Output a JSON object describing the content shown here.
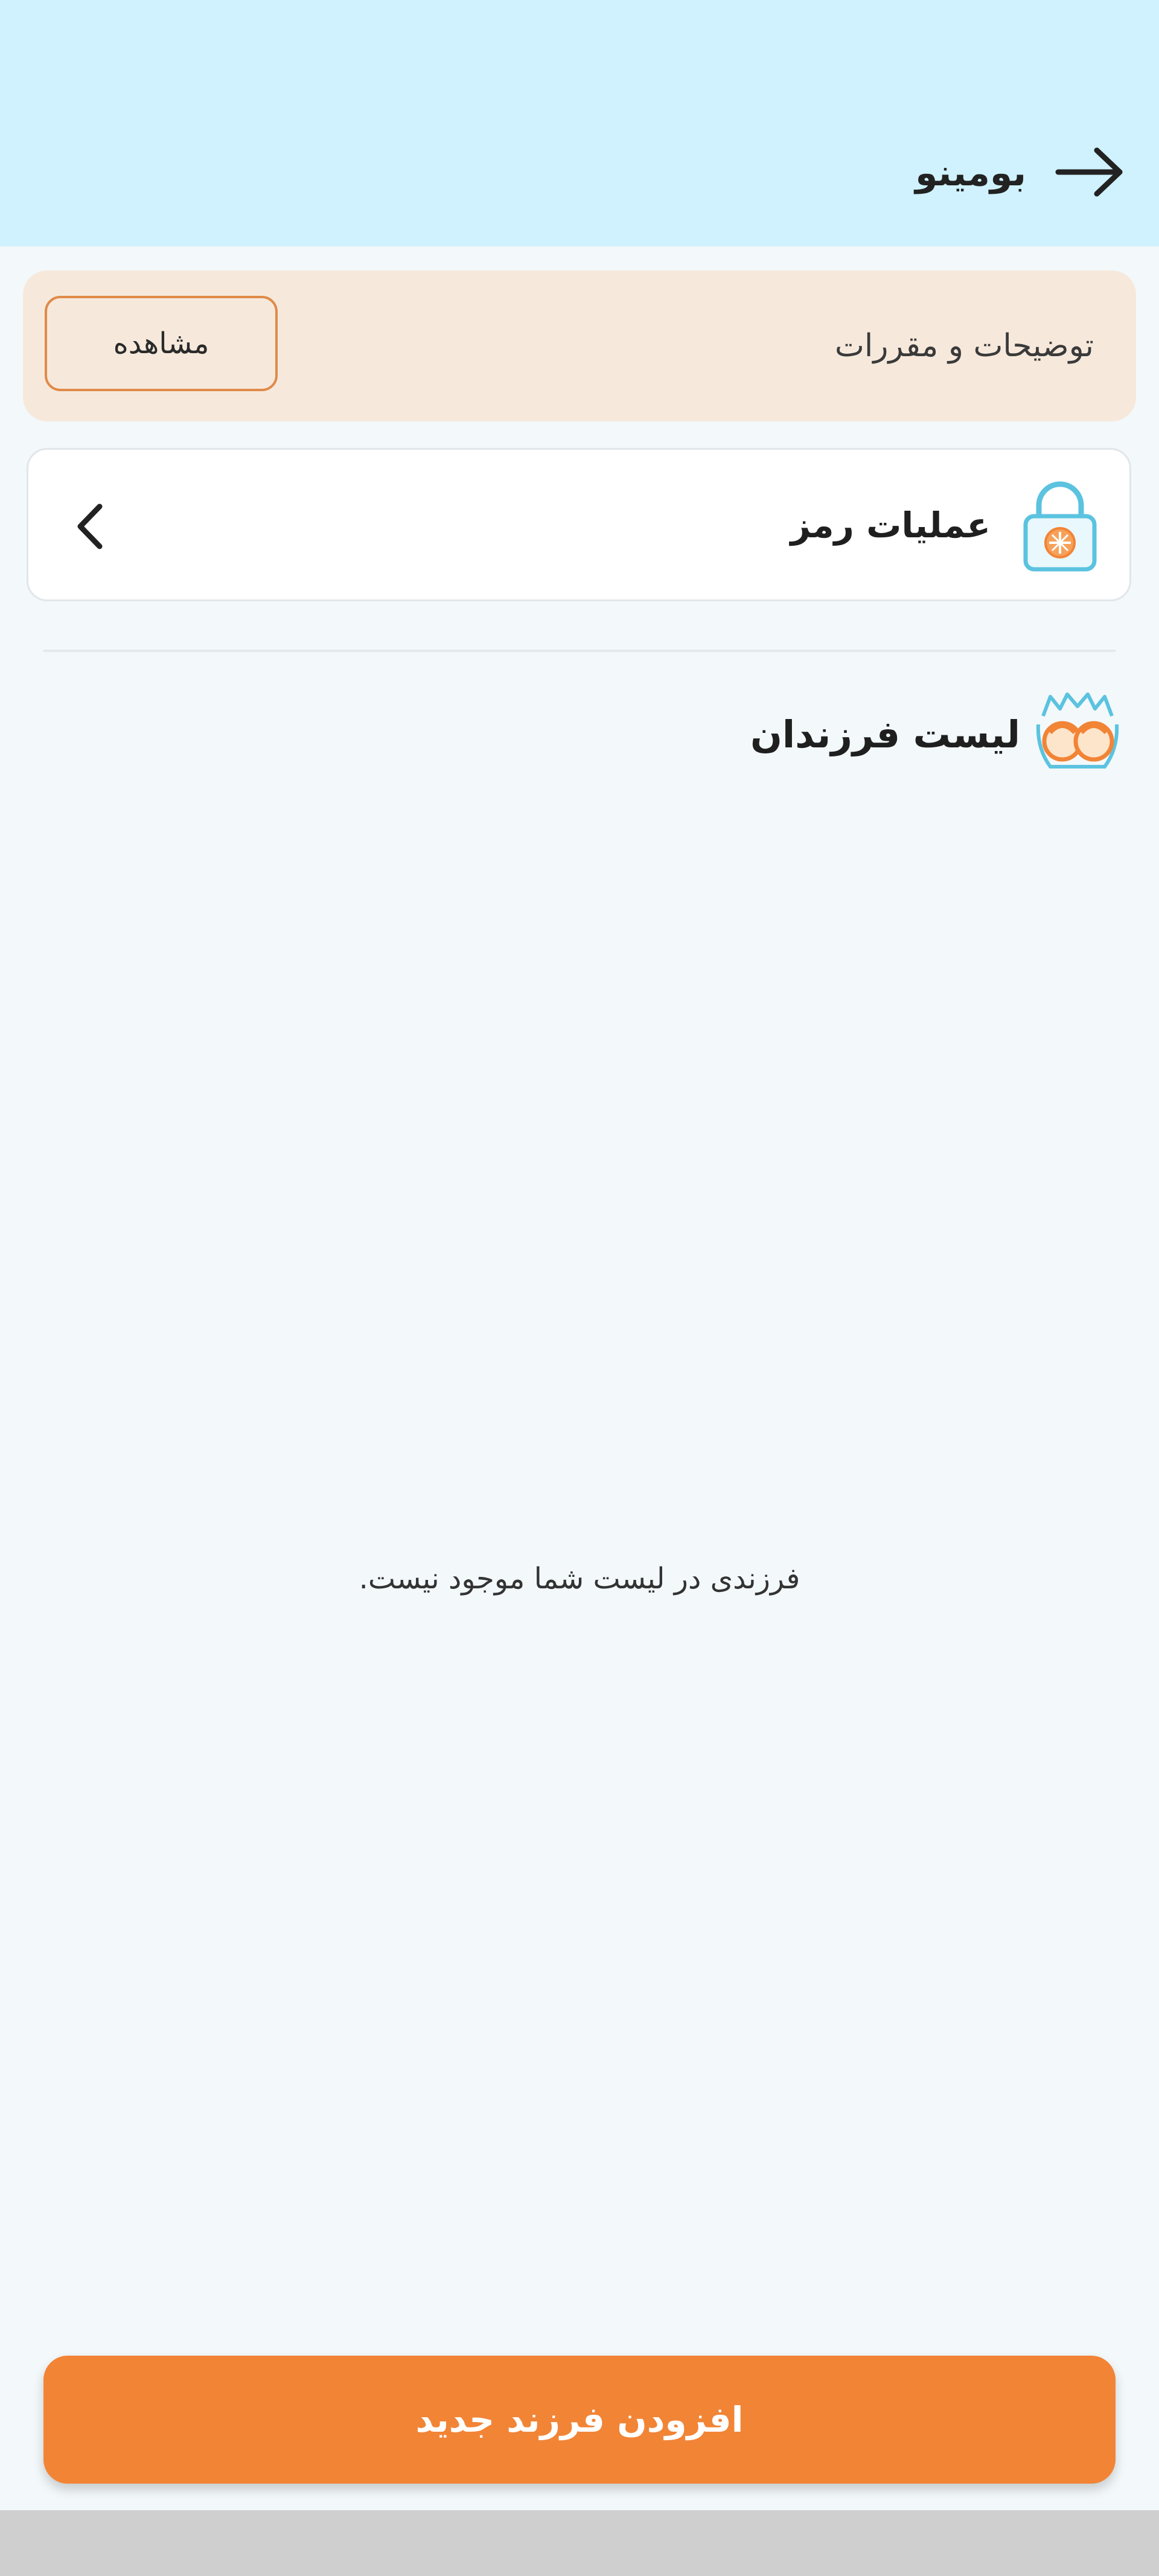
{
  "header": {
    "title": "بومینو",
    "back_icon": "arrow-right-icon"
  },
  "rules": {
    "label": "توضیحات و مقررات",
    "view_button": "مشاهده"
  },
  "password_operations": {
    "label": "عملیات رمز",
    "icon": "lock-icon",
    "chevron": "chevron-left-icon"
  },
  "children": {
    "title": "لیست فرزندان",
    "icon": "children-icon",
    "empty_message": "فرزندی در لیست شما موجود نیست."
  },
  "actions": {
    "add_child": "افزودن فرزند جدید"
  },
  "colors": {
    "header_bg": "#cff2fe",
    "banner_bg": "#f6e9dc",
    "accent_orange": "#f28436",
    "accent_cyan": "#5bc3e0"
  }
}
